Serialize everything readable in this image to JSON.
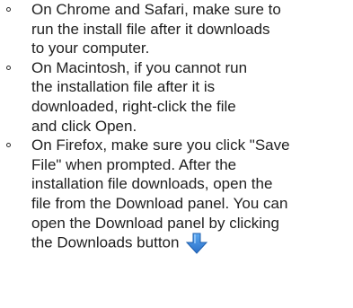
{
  "instructions": {
    "items": [
      {
        "lines": [
          "On Chrome and Safari, make sure to",
          "run the  install file after it downloads",
          "to your  computer."
        ]
      },
      {
        "lines": [
          "On Macintosh, if you cannot run",
          "the  installation file after it is",
          "downloaded,  right-click the file",
          "and click Open."
        ]
      },
      {
        "lines": [
          "On Firefox, make sure you click \"Save",
          "File\" when prompted. After the",
          "installation  file downloads, open the",
          "file from the  Download panel. You can",
          "open the  Download panel by clicking",
          "the  Downloads button"
        ]
      }
    ],
    "downloads_icon": "download-arrow-icon",
    "icon_color": "#3a8ee6"
  }
}
